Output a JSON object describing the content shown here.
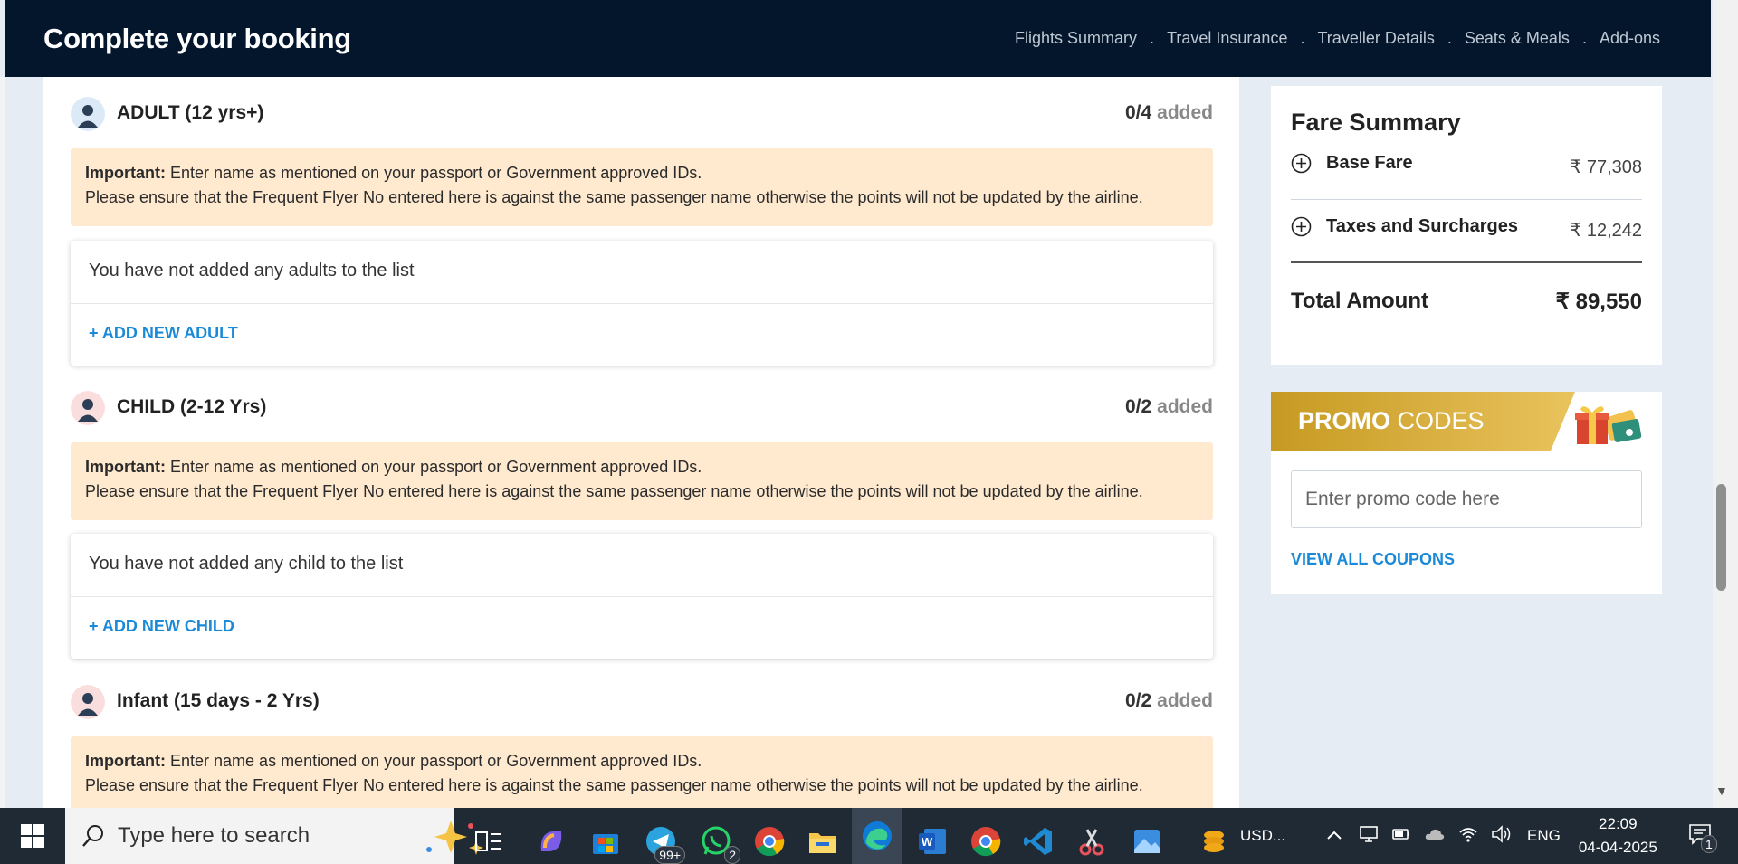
{
  "header": {
    "title": "Complete your booking",
    "steps": [
      "Flights Summary",
      "Travel Insurance",
      "Traveller Details",
      "Seats & Meals",
      "Add-ons"
    ],
    "separator": "."
  },
  "sections": [
    {
      "title": "ADULT (12 yrs+)",
      "count": "0/4",
      "count_label": "added",
      "important_label": "Important:",
      "important_text": " Enter name as mentioned on your passport or Government approved IDs.",
      "note": "Please ensure that the Frequent Flyer No entered here is against the same passenger name otherwise the points will not be updated by the airline.",
      "empty_text": "You have not added any adults to the list",
      "add_label": "+ ADD NEW ADULT"
    },
    {
      "title": "CHILD (2-12 Yrs)",
      "count": "0/2",
      "count_label": "added",
      "important_label": "Important:",
      "important_text": " Enter name as mentioned on your passport or Government approved IDs.",
      "note": "Please ensure that the Frequent Flyer No entered here is against the same passenger name otherwise the points will not be updated by the airline.",
      "empty_text": "You have not added any child to the list",
      "add_label": "+ ADD NEW CHILD"
    },
    {
      "title": "Infant (15 days - 2 Yrs)",
      "count": "0/2",
      "count_label": "added",
      "important_label": "Important:",
      "important_text": " Enter name as mentioned on your passport or Government approved IDs.",
      "note": "Please ensure that the Frequent Flyer No entered here is against the same passenger name otherwise the points will not be updated by the airline."
    }
  ],
  "fare": {
    "title": "Fare Summary",
    "base_label": "Base Fare",
    "base_amount": "₹ 77,308",
    "taxes_label": "Taxes and Surcharges",
    "taxes_amount": "₹ 12,242",
    "total_label": "Total Amount",
    "total_amount": "₹ 89,550"
  },
  "promo": {
    "title_bold": "PROMO",
    "title_rest": " CODES",
    "placeholder": "Enter promo code here",
    "view_all": "VIEW ALL COUPONS"
  },
  "taskbar": {
    "search_placeholder": "Type here to search",
    "edge_badge": "99+",
    "whatsapp_badge": "2",
    "stock_label": "USD...",
    "language": "ENG",
    "time": "22:09",
    "date": "04-04-2025",
    "notification_count": "1"
  },
  "colors": {
    "header_bg": "#03162c",
    "accent": "#1a8ad8",
    "notice_bg": "#ffe9cf",
    "promo_gold": "#c69a22"
  }
}
